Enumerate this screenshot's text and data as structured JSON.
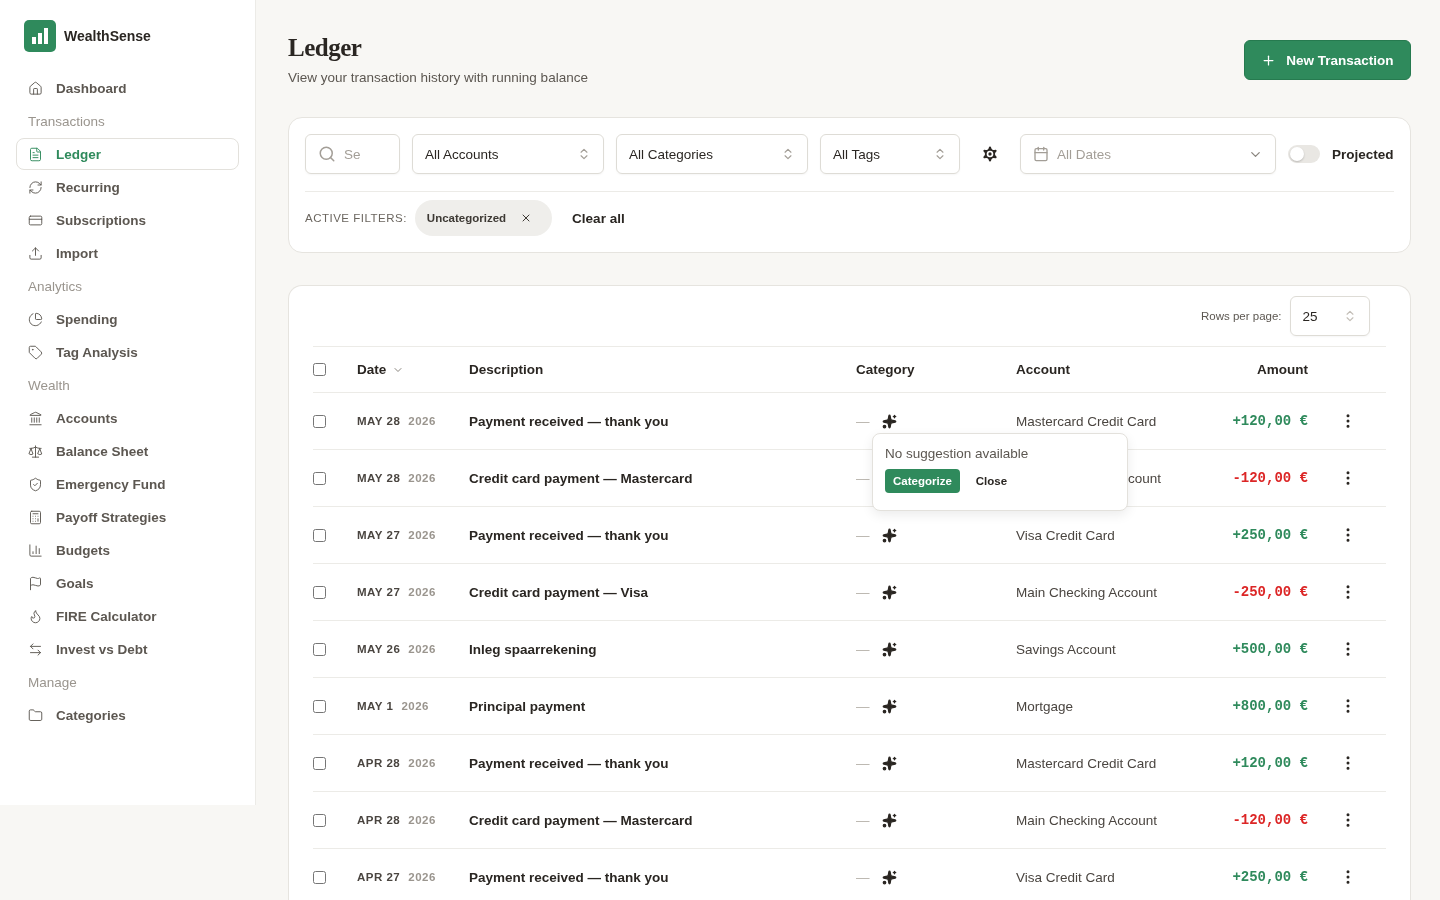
{
  "brand": {
    "name": "WealthSense"
  },
  "nav": [
    {
      "items": [
        {
          "label": "Dashboard",
          "selected": false
        }
      ]
    },
    {
      "heading": "Transactions",
      "items": [
        {
          "label": "Ledger",
          "selected": true
        },
        {
          "label": "Recurring",
          "selected": false
        },
        {
          "label": "Subscriptions",
          "selected": false
        },
        {
          "label": "Import",
          "selected": false
        }
      ]
    },
    {
      "heading": "Analytics",
      "items": [
        {
          "label": "Spending",
          "selected": false
        },
        {
          "label": "Tag Analysis",
          "selected": false
        }
      ]
    },
    {
      "heading": "Wealth",
      "items": [
        {
          "label": "Accounts",
          "selected": false
        },
        {
          "label": "Balance Sheet",
          "selected": false
        },
        {
          "label": "Emergency Fund",
          "selected": false
        },
        {
          "label": "Payoff Strategies",
          "selected": false
        },
        {
          "label": "Budgets",
          "selected": false
        },
        {
          "label": "Goals",
          "selected": false
        },
        {
          "label": "FIRE Calculator",
          "selected": false
        },
        {
          "label": "Invest vs Debt",
          "selected": false
        }
      ]
    },
    {
      "heading": "Manage",
      "items": [
        {
          "label": "Categories",
          "selected": false
        }
      ]
    }
  ],
  "header": {
    "title": "Ledger",
    "subtitle": "View your transaction history with running balance",
    "button": "New Transaction"
  },
  "filters": {
    "search_placeholder": "Se",
    "accounts": "All Accounts",
    "categories": "All Categories",
    "tags": "All Tags",
    "dates_placeholder": "All Dates",
    "projected": {
      "label": "Projected",
      "on": false
    },
    "active_label": "ACTIVE FILTERS:",
    "chips": [
      "Uncategorized"
    ],
    "clear": "Clear all"
  },
  "table": {
    "rows_per_page_label": "Rows per page:",
    "rows_per_page": "25",
    "columns": [
      "Date",
      "Description",
      "Category",
      "Account",
      "Amount"
    ],
    "all_checked": false,
    "rows": [
      {
        "date": "MAY 28",
        "year": "2026",
        "description": "Payment received — thank you",
        "category": "—",
        "account": "Mastercard Credit Card",
        "amount": "+120,00 €",
        "color": "#2f8a5c",
        "checked": false,
        "covered": false
      },
      {
        "date": "MAY 28",
        "year": "2026",
        "description": "Credit card payment — Mastercard",
        "category": "—",
        "account": "count",
        "amount": "-120,00 €",
        "color": "#dc2626",
        "checked": false,
        "covered": true
      },
      {
        "date": "MAY 27",
        "year": "2026",
        "description": "Payment received — thank you",
        "category": "—",
        "account": "Visa Credit Card",
        "amount": "+250,00 €",
        "color": "#2f8a5c",
        "checked": false,
        "covered": false
      },
      {
        "date": "MAY 27",
        "year": "2026",
        "description": "Credit card payment — Visa",
        "category": "—",
        "account": "Main Checking Account",
        "amount": "-250,00 €",
        "color": "#dc2626",
        "checked": false,
        "covered": false
      },
      {
        "date": "MAY 26",
        "year": "2026",
        "description": "Inleg spaarrekening",
        "category": "—",
        "account": "Savings Account",
        "amount": "+500,00 €",
        "color": "#2f8a5c",
        "checked": false,
        "covered": false
      },
      {
        "date": "MAY 1",
        "year": "2026",
        "description": "Principal payment",
        "category": "—",
        "account": "Mortgage",
        "amount": "+800,00 €",
        "color": "#2f8a5c",
        "checked": false,
        "covered": false
      },
      {
        "date": "APR 28",
        "year": "2026",
        "description": "Payment received — thank you",
        "category": "—",
        "account": "Mastercard Credit Card",
        "amount": "+120,00 €",
        "color": "#2f8a5c",
        "checked": false,
        "covered": false
      },
      {
        "date": "APR 28",
        "year": "2026",
        "description": "Credit card payment — Mastercard",
        "category": "—",
        "account": "Main Checking Account",
        "amount": "-120,00 €",
        "color": "#dc2626",
        "checked": false,
        "covered": false
      },
      {
        "date": "APR 27",
        "year": "2026",
        "description": "Payment received — thank you",
        "category": "—",
        "account": "Visa Credit Card",
        "amount": "+250,00 €",
        "color": "#2f8a5c",
        "checked": false,
        "covered": false
      }
    ],
    "popover": {
      "message": "No suggestion available",
      "primary": "Categorize",
      "secondary": "Close"
    }
  }
}
